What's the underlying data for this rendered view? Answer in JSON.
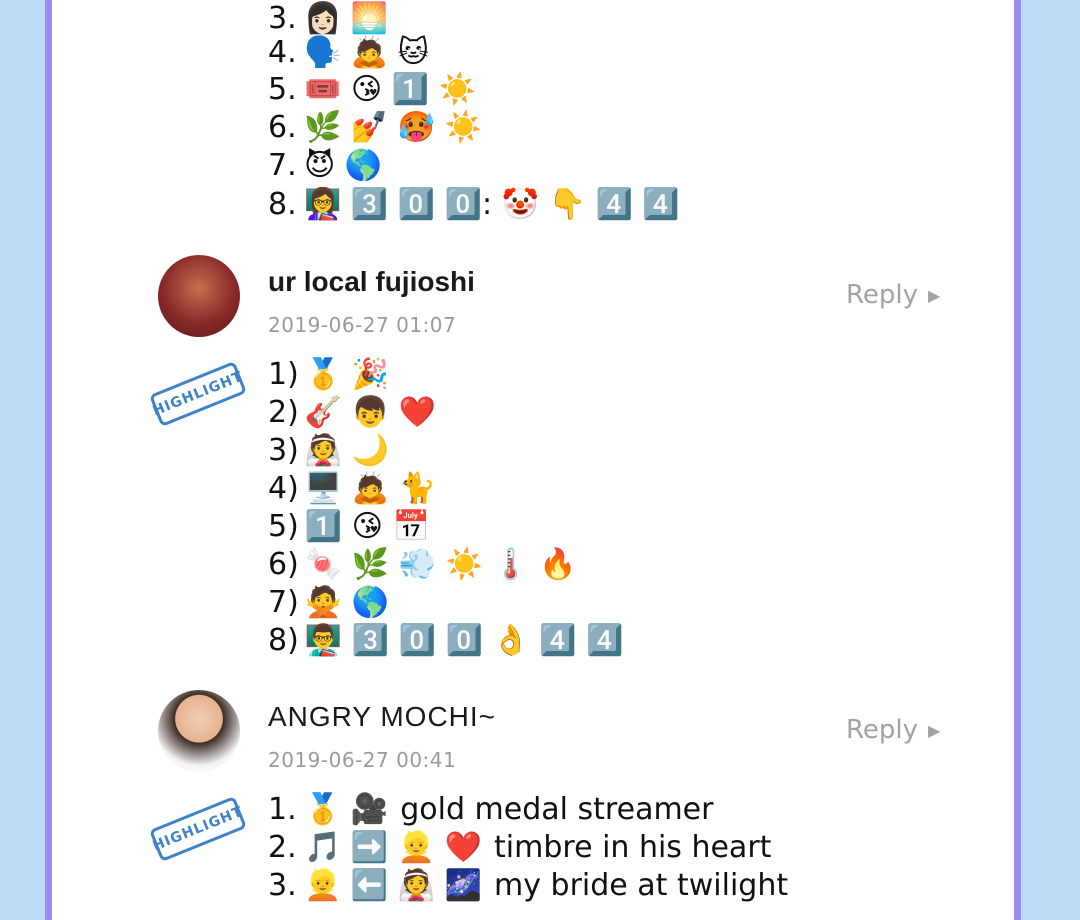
{
  "thread": {
    "prev_comment_lines": [
      {
        "num": "3.",
        "emoji": "👩🏻 🌅",
        "text": ""
      },
      {
        "num": "4.",
        "emoji": "🗣️ 🙇 🐱",
        "text": ""
      },
      {
        "num": "5.",
        "emoji": "🎟️ 😘 1️⃣ ☀️",
        "text": ""
      },
      {
        "num": "6.",
        "emoji": "🌿 💅 🥵 ☀️",
        "text": ""
      },
      {
        "num": "7.",
        "emoji": "😈 🌎",
        "text": ""
      },
      {
        "num": "8.",
        "emoji": "👩‍🏫 3️⃣ 0️⃣ 0️⃣: 🤡 👇 4️⃣ 4️⃣",
        "text": ""
      }
    ],
    "comments": [
      {
        "username": "ur local fujioshi",
        "timestamp": "2019-06-27 01:07",
        "reply_label": "Reply",
        "highlight_label": "HIGHLIGHT",
        "lines": [
          {
            "num": "1)",
            "emoji": "🥇 🎉",
            "text": ""
          },
          {
            "num": "2)",
            "emoji": "🎸 👦 ❤️",
            "text": ""
          },
          {
            "num": "3)",
            "emoji": "👰 🌙",
            "text": ""
          },
          {
            "num": "4)",
            "emoji": "🖥️ 🙇 🐈",
            "text": ""
          },
          {
            "num": "5)",
            "emoji": "1️⃣ 😘 📅",
            "text": ""
          },
          {
            "num": "6)",
            "emoji": "🍬 🌿 💨 ☀️ 🌡️ 🔥",
            "text": ""
          },
          {
            "num": "7)",
            "emoji": "🙅 🌎",
            "text": ""
          },
          {
            "num": "8)",
            "emoji": "👨‍🏫 3️⃣ 0️⃣ 0️⃣ 👌 4️⃣ 4️⃣",
            "text": ""
          }
        ]
      },
      {
        "username": "ANGRY MOCHI~",
        "timestamp": "2019-06-27 00:41",
        "reply_label": "Reply",
        "highlight_label": "HIGHLIGHT",
        "lines": [
          {
            "num": "1.",
            "emoji": "🥇 🎥",
            "text": "gold medal streamer"
          },
          {
            "num": "2.",
            "emoji": "🎵 ➡️ 👱 ❤️",
            "text": "timbre in his heart"
          },
          {
            "num": "3.",
            "emoji": "👱 ⬅️ 👰 🌌",
            "text": "my bride at twilight"
          }
        ]
      }
    ]
  }
}
